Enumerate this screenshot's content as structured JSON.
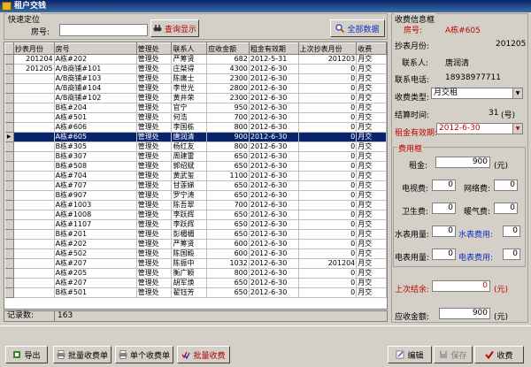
{
  "window": {
    "title": "租户交钱"
  },
  "search": {
    "legend": "快速定位",
    "room_label": "房号:",
    "room_value": "",
    "query_label": "查询显示",
    "all_label": "全部数据"
  },
  "table": {
    "columns": [
      "抄表月份",
      "房号",
      "管理处",
      "联系人",
      "应收金额",
      "租金有效期",
      "上次抄表月份",
      "收费"
    ],
    "rows": [
      [
        "201204",
        "A栋#202",
        "管理处",
        "严筹贤",
        "682",
        "2012-5-31",
        "201203",
        "月交"
      ],
      [
        "201205",
        "A/B商铺#101",
        "管理处",
        "庄桀得",
        "4300",
        "2012-6-30",
        "0",
        "月交"
      ],
      [
        "",
        "A/B商铺#103",
        "管理处",
        "陈庸士",
        "2300",
        "2012-6-30",
        "0",
        "月交"
      ],
      [
        "",
        "A/B商铺#104",
        "管理处",
        "李世光",
        "2800",
        "2012-6-30",
        "0",
        "月交"
      ],
      [
        "",
        "A/B商铺#102",
        "管理处",
        "黄井荣",
        "2300",
        "2012-6-30",
        "0",
        "月交"
      ],
      [
        "",
        "B栋#204",
        "管理处",
        "官宁",
        "950",
        "2012-6-30",
        "0",
        "月交"
      ],
      [
        "",
        "A栋#501",
        "管理处",
        "何浩",
        "700",
        "2012-6-30",
        "0",
        "月交"
      ],
      [
        "",
        "A栋#606",
        "管理处",
        "李国栋",
        "800",
        "2012-6-30",
        "0",
        "月交"
      ],
      [
        "",
        "A栋#605",
        "管理处",
        "唐润清",
        "900",
        "2012-6-30",
        "0",
        "月交"
      ],
      [
        "",
        "B栋#305",
        "管理处",
        "杨红友",
        "800",
        "2012-6-30",
        "0",
        "月交"
      ],
      [
        "",
        "B栋#307",
        "管理处",
        "周建雷",
        "650",
        "2012-6-30",
        "0",
        "月交"
      ],
      [
        "",
        "B栋#508",
        "管理处",
        "郭绍斌",
        "650",
        "2012-6-30",
        "0",
        "月交"
      ],
      [
        "",
        "A栋#704",
        "管理处",
        "黄武玺",
        "1100",
        "2012-6-30",
        "0",
        "月交"
      ],
      [
        "",
        "A栋#707",
        "管理处",
        "甘莲娣",
        "650",
        "2012-6-30",
        "0",
        "月交"
      ],
      [
        "",
        "B栋#907",
        "管理处",
        "罗宁涛",
        "650",
        "2012-6-30",
        "0",
        "月交"
      ],
      [
        "",
        "A栋#1003",
        "管理处",
        "陈吾翠",
        "700",
        "2012-6-30",
        "0",
        "月交"
      ],
      [
        "",
        "A栋#1008",
        "管理处",
        "李跃辉",
        "650",
        "2012-6-30",
        "0",
        "月交"
      ],
      [
        "",
        "A栋#1107",
        "管理处",
        "李跃辉",
        "650",
        "2012-6-30",
        "0",
        "月交"
      ],
      [
        "",
        "B栋#201",
        "管理处",
        "彭楣楣",
        "650",
        "2012-6-30",
        "0",
        "月交"
      ],
      [
        "",
        "A栋#202",
        "管理处",
        "严筹贤",
        "600",
        "2012-6-30",
        "0",
        "月交"
      ],
      [
        "",
        "A栋#502",
        "管理处",
        "陈国殿",
        "600",
        "2012-6-30",
        "0",
        "月交"
      ],
      [
        "",
        "A栋#207",
        "管理处",
        "陈振中",
        "1032",
        "2012-6-30",
        "201204",
        "月交"
      ],
      [
        "",
        "A栋#205",
        "管理处",
        "衡广颖",
        "800",
        "2012-6-30",
        "0",
        "月交"
      ],
      [
        "",
        "A栋#207",
        "管理处",
        "胡军焕",
        "650",
        "2012-6-30",
        "0",
        "月交"
      ],
      [
        "",
        "B栋#501",
        "管理处",
        "翟钰芳",
        "650",
        "2012-6-30",
        "0",
        "月交"
      ]
    ],
    "selected_row": 8
  },
  "footer": {
    "count_label": "记录数:",
    "count_value": "163"
  },
  "panel": {
    "title": "收费信息框",
    "room_label": "房号:",
    "room_value": "A栋#605",
    "month_label": "抄表月份:",
    "month_value": "201205",
    "contact_label": "联系人:",
    "contact_value": "唐润清",
    "phone_label": "联系电话:",
    "phone_value": "18938977711",
    "type_label": "收费类型:",
    "type_value": "月交租",
    "period_label": "结算时间:",
    "period_value": "31",
    "period_unit": "(号)",
    "expiry_label": "租金有效期:",
    "expiry_value": "2012-6-30"
  },
  "fees": {
    "title": "费用框",
    "rent_label": "租金:",
    "rent_value": "900",
    "rent_unit": "(元)",
    "tv_label": "电视费:",
    "tv_value": "0",
    "net_label": "网络费:",
    "net_value": "0",
    "sanitary_label": "卫生费:",
    "sanitary_value": "0",
    "heating_label": "暖气费:",
    "heating_value": "0",
    "water_label": "水表用量:",
    "water_value": "0",
    "water_fee_label": "水表费用:",
    "water_fee_value": "0",
    "elec_label": "电表用量:",
    "elec_value": "0",
    "elec_fee_label": "电表费用:",
    "elec_fee_value": "0"
  },
  "totals": {
    "last_balance_label": "上次结余:",
    "last_balance_value": "0",
    "last_balance_unit": "(元)",
    "due_label": "应收金额:",
    "due_value": "900",
    "due_unit": "(元)"
  },
  "buttons": {
    "export": "导出",
    "batch_bill": "批量收费单",
    "single_bill": "单个收费单",
    "batch_charge": "批量收费",
    "edit": "编辑",
    "save": "保存",
    "charge": "收费"
  }
}
